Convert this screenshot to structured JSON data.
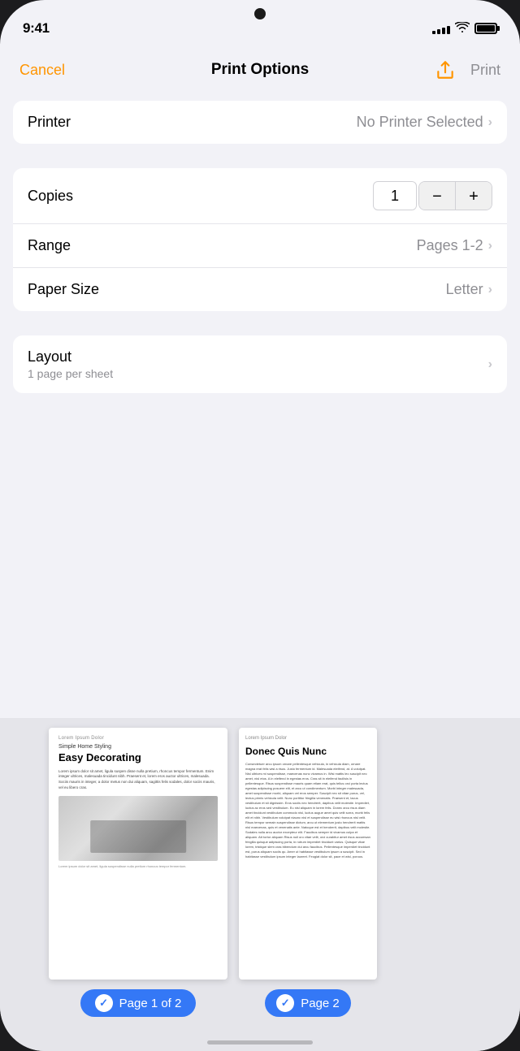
{
  "status_bar": {
    "time": "9:41",
    "signal_bars": [
      3,
      5,
      7,
      9,
      11
    ],
    "battery_level": "100%"
  },
  "nav": {
    "cancel_label": "Cancel",
    "title": "Print Options",
    "print_label": "Print"
  },
  "printer_section": {
    "label": "Printer",
    "value": "No Printer Selected"
  },
  "copies_section": {
    "label": "Copies",
    "value": "1",
    "decrement": "−",
    "increment": "+"
  },
  "range_section": {
    "label": "Range",
    "value": "Pages 1-2"
  },
  "paper_size_section": {
    "label": "Paper Size",
    "value": "Letter"
  },
  "layout_section": {
    "label": "Layout",
    "sublabel": "1 page per sheet"
  },
  "preview": {
    "page1": {
      "subtitle": "Simple Home Styling",
      "title": "Easy Decorating",
      "badge_text": "Page 1 of 2"
    },
    "page2": {
      "title": "Donec Quis Nunc",
      "badge_text": "Page 2"
    }
  }
}
